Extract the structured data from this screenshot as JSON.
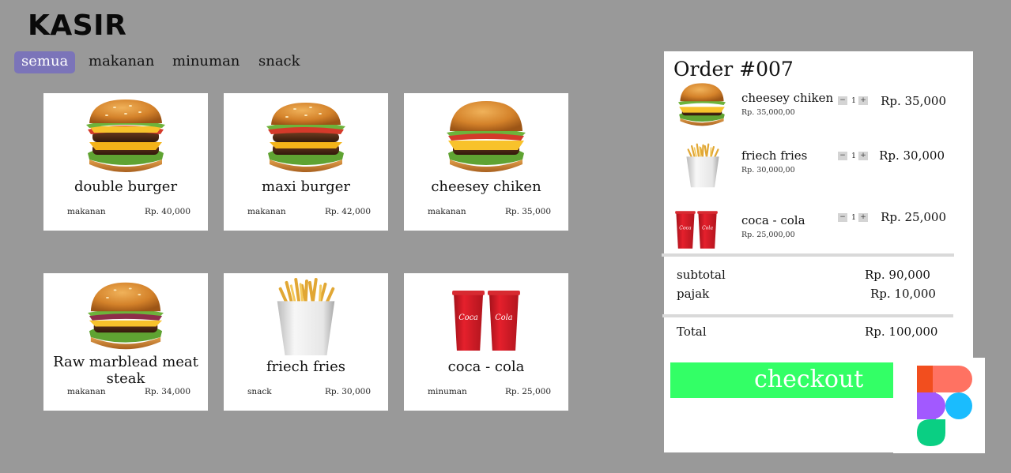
{
  "app": {
    "title": "KASIR"
  },
  "tabs": [
    {
      "label": "semua",
      "active": true
    },
    {
      "label": "makanan",
      "active": false
    },
    {
      "label": "minuman",
      "active": false
    },
    {
      "label": "snack",
      "active": false
    }
  ],
  "products": [
    {
      "name": "double burger",
      "category": "makanan",
      "price": "Rp. 40,000",
      "icon": "double-burger-image"
    },
    {
      "name": "maxi burger",
      "category": "makanan",
      "price": "Rp. 42,000",
      "icon": "maxi-burger-image"
    },
    {
      "name": "cheesey chiken",
      "category": "makanan",
      "price": "Rp. 35,000",
      "icon": "cheeseburger-image"
    },
    {
      "name": "Raw marblead meat steak",
      "category": "makanan",
      "price": "Rp. 34,000",
      "icon": "steak-burger-image"
    },
    {
      "name": "friech fries",
      "category": "snack",
      "price": "Rp. 30,000",
      "icon": "fries-image"
    },
    {
      "name": "coca - cola",
      "category": "minuman",
      "price": "Rp. 25,000",
      "icon": "cola-cups-image"
    }
  ],
  "order": {
    "title": "Order #007",
    "items": [
      {
        "name": "cheesey chiken",
        "unit_price": "Rp. 35,000,00",
        "qty": "1",
        "minus": "−",
        "plus": "+",
        "total": "Rp. 35,000"
      },
      {
        "name": "friech fries",
        "unit_price": "Rp. 30,000,00",
        "qty": "1",
        "minus": "−",
        "plus": "+",
        "total": "Rp. 30,000"
      },
      {
        "name": "coca - cola",
        "unit_price": "Rp. 25,000,00",
        "qty": "1",
        "minus": "−",
        "plus": "+",
        "total": "Rp. 25,000"
      }
    ],
    "subtotal_label": "subtotal",
    "subtotal_value": "Rp. 90,000",
    "tax_label": "pajak",
    "tax_value": "Rp. 10,000",
    "total_label": "Total",
    "total_value": "Rp. 100,000",
    "checkout_label": "checkout"
  },
  "colors": {
    "background": "#999999",
    "tab_active": "#7b74b9",
    "checkout": "#33ff66"
  }
}
